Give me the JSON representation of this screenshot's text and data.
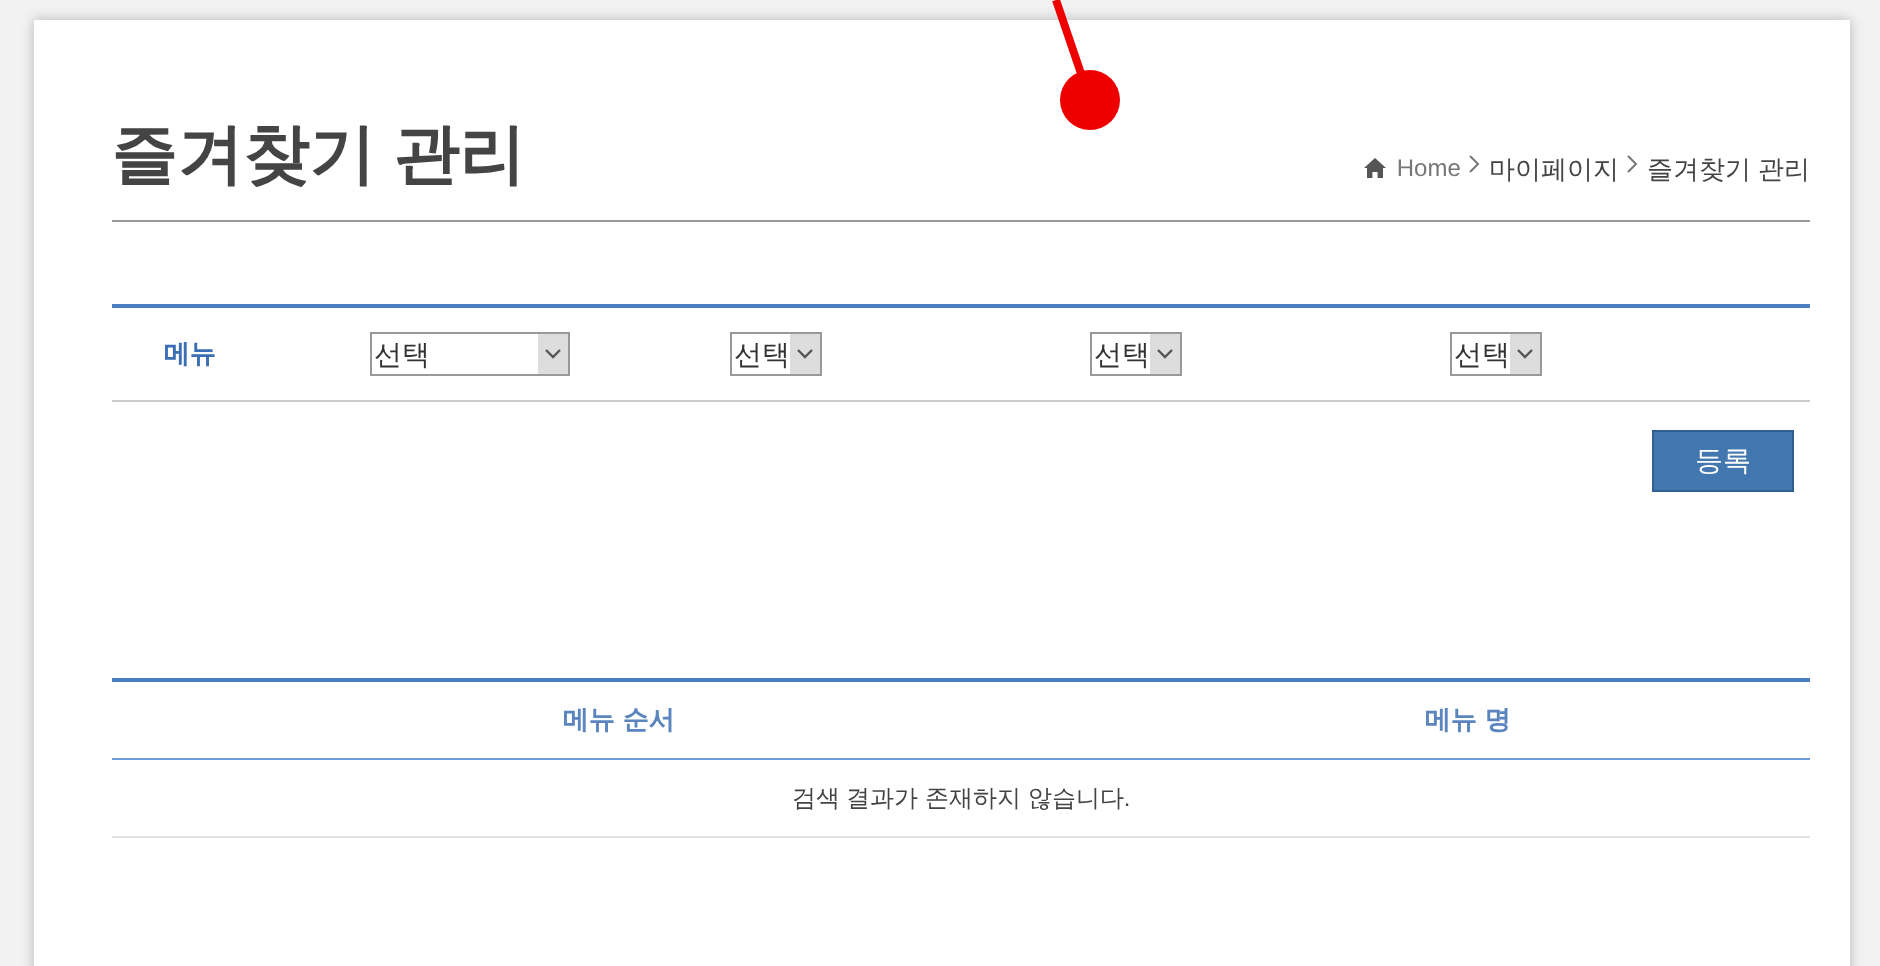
{
  "page_title": "즐겨찾기 관리",
  "breadcrumb": [
    "Home",
    "마이페이지",
    "즐겨찾기 관리"
  ],
  "filter": {
    "label": "메뉴",
    "selects": [
      {
        "value": "선택",
        "kind": "wide"
      },
      {
        "value": "선택",
        "kind": "narrow"
      },
      {
        "value": "선택",
        "kind": "narrow"
      },
      {
        "value": "선택",
        "kind": "narrow"
      }
    ]
  },
  "register_button": "등록",
  "table": {
    "columns": [
      "메뉴 순서",
      "메뉴 명"
    ],
    "empty_message": "검색 결과가 존재하지 않습니다."
  }
}
